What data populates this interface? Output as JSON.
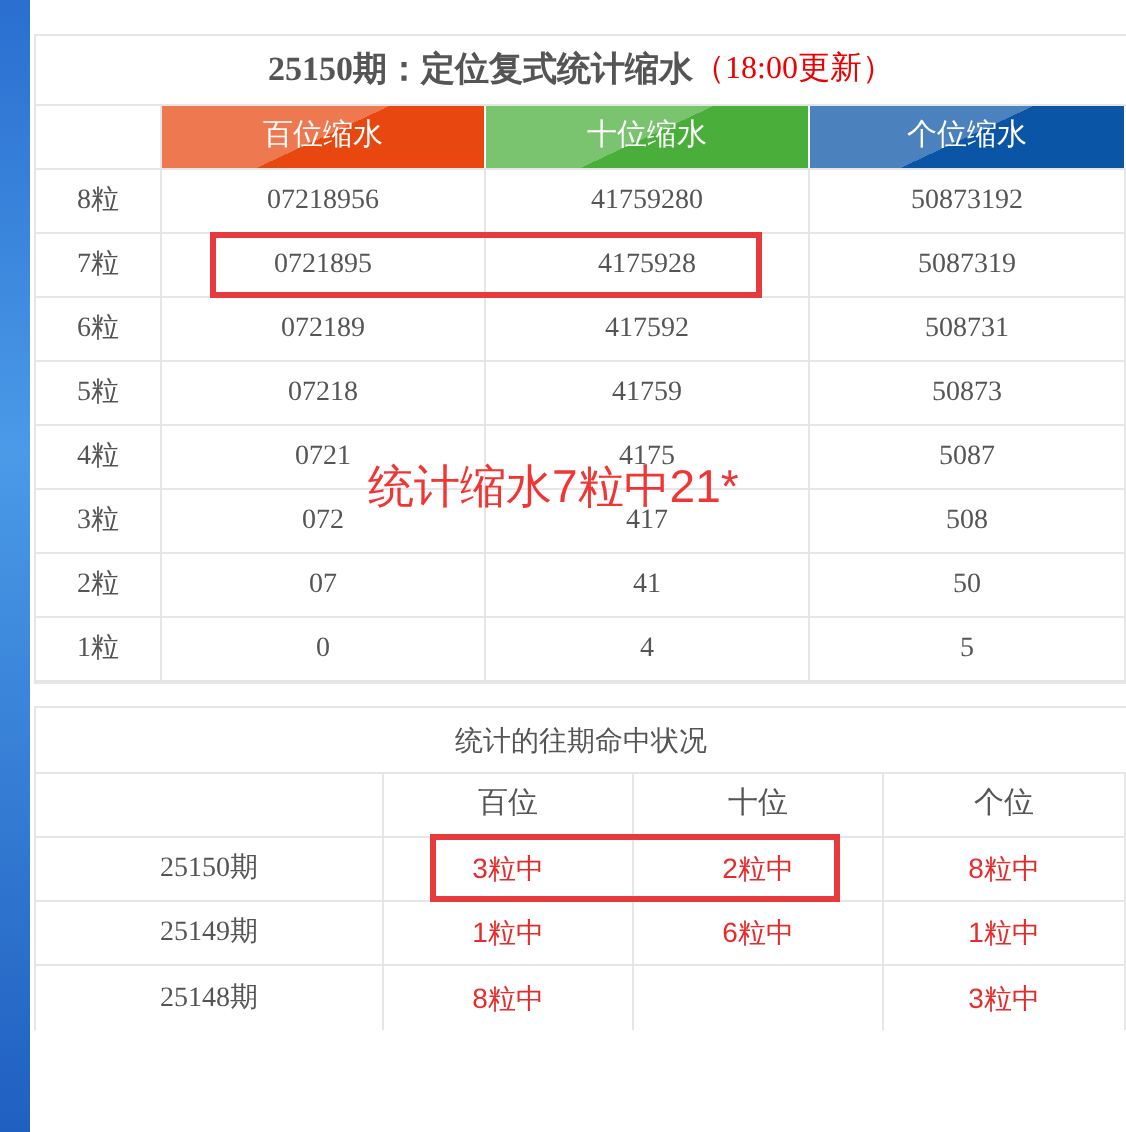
{
  "stats_table": {
    "title": "25150期：定位复式统计缩水",
    "title_note": "（18:00更新）",
    "columns": [
      {
        "label": "百位缩水",
        "color": "#e8470f"
      },
      {
        "label": "十位缩水",
        "color": "#4aae3a"
      },
      {
        "label": "个位缩水",
        "color": "#0a55a6"
      }
    ],
    "rows": [
      {
        "label": "8粒",
        "cells": [
          "07218956",
          "41759280",
          "50873192"
        ],
        "highlighted": false
      },
      {
        "label": "7粒",
        "cells": [
          "0721895",
          "4175928",
          "5087319"
        ],
        "highlighted": true
      },
      {
        "label": "6粒",
        "cells": [
          "072189",
          "417592",
          "508731"
        ],
        "highlighted": false
      },
      {
        "label": "5粒",
        "cells": [
          "07218",
          "41759",
          "50873"
        ],
        "highlighted": false
      },
      {
        "label": "4粒",
        "cells": [
          "0721",
          "4175",
          "5087"
        ],
        "highlighted": false
      },
      {
        "label": "3粒",
        "cells": [
          "072",
          "417",
          "508"
        ],
        "highlighted": false
      },
      {
        "label": "2粒",
        "cells": [
          "07",
          "41",
          "50"
        ],
        "highlighted": false
      },
      {
        "label": "1粒",
        "cells": [
          "0",
          "4",
          "5"
        ],
        "highlighted": false
      }
    ],
    "annotation": "统计缩水7粒中21*"
  },
  "history_table": {
    "title": "统计的往期命中状况",
    "columns": [
      "百位",
      "十位",
      "个位"
    ],
    "rows": [
      {
        "period": "25150期",
        "cells": [
          "3粒中",
          "2粒中",
          "8粒中"
        ],
        "highlighted": true
      },
      {
        "period": "25149期",
        "cells": [
          "1粒中",
          "6粒中",
          "1粒中"
        ],
        "highlighted": false
      },
      {
        "period": "25148期",
        "cells": [
          "8粒中",
          null,
          "3粒中"
        ],
        "highlighted": false
      }
    ]
  }
}
